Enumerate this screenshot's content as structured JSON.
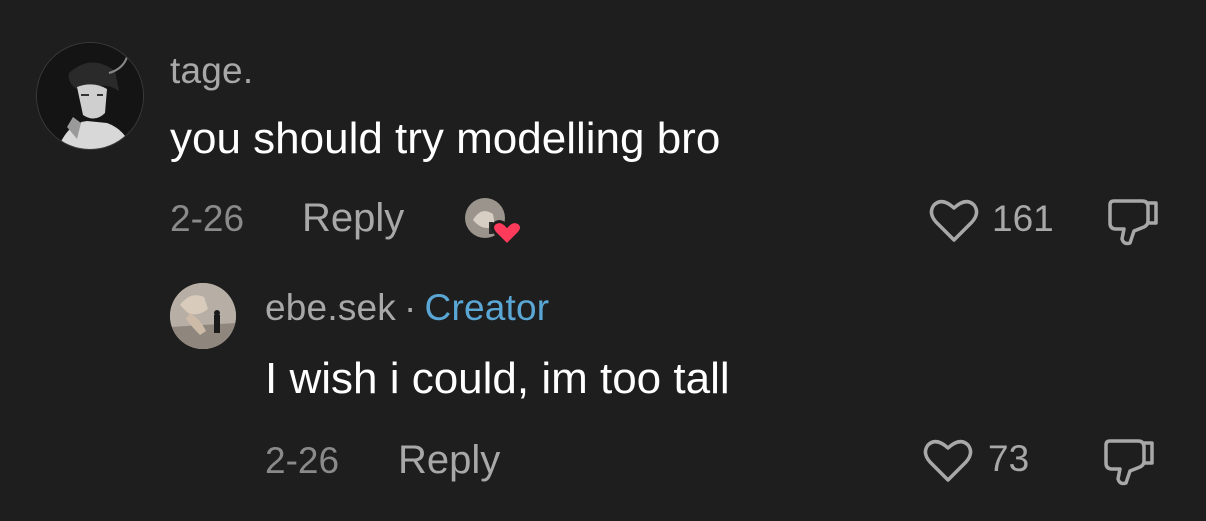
{
  "comments": [
    {
      "username": "tage.",
      "text": "you should try modelling bro",
      "date": "2-26",
      "reply_label": "Reply",
      "like_count": "161",
      "liked_by_creator": true,
      "avatar_icon": "avatar-illustration-icon"
    }
  ],
  "replies": [
    {
      "username": "ebe.sek",
      "separator": "·",
      "badge": "Creator",
      "text": "I wish i could, im too tall",
      "date": "2-26",
      "reply_label": "Reply",
      "like_count": "73",
      "avatar_icon": "avatar-photo-icon"
    }
  ],
  "colors": {
    "background": "#1e1e1e",
    "primary_text": "#ffffff",
    "secondary_text": "#a8a8a8",
    "creator_badge": "#5aa7d6",
    "heart_badge": "#ff3b5c"
  }
}
